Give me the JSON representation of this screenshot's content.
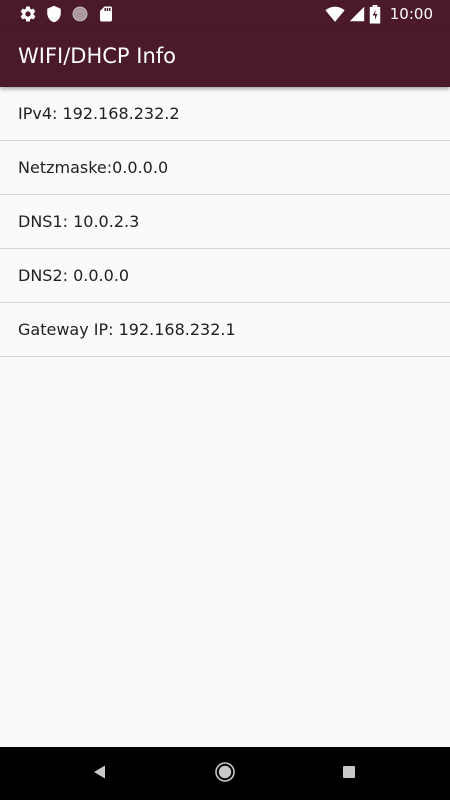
{
  "status_bar": {
    "time": "10:00",
    "left_icons": [
      "gear-icon",
      "shield-icon",
      "circle-pattern-icon",
      "sd-card-icon"
    ],
    "right_icons": [
      "wifi-icon",
      "cell-signal-icon",
      "battery-charging-icon"
    ]
  },
  "app_bar": {
    "title": "WIFI/DHCP Info"
  },
  "list": {
    "items": [
      {
        "label": "IPv4: 192.168.232.2"
      },
      {
        "label": "Netzmaske:0.0.0.0"
      },
      {
        "label": "DNS1: 10.0.2.3"
      },
      {
        "label": "DNS2: 0.0.0.0"
      },
      {
        "label": "Gateway IP: 192.168.232.1"
      }
    ]
  },
  "nav_bar": {
    "buttons": [
      "back-icon",
      "home-icon",
      "recents-icon"
    ]
  },
  "colors": {
    "primary": "#4a1a2c",
    "background": "#fafafa",
    "divider": "#d6d6d6"
  }
}
